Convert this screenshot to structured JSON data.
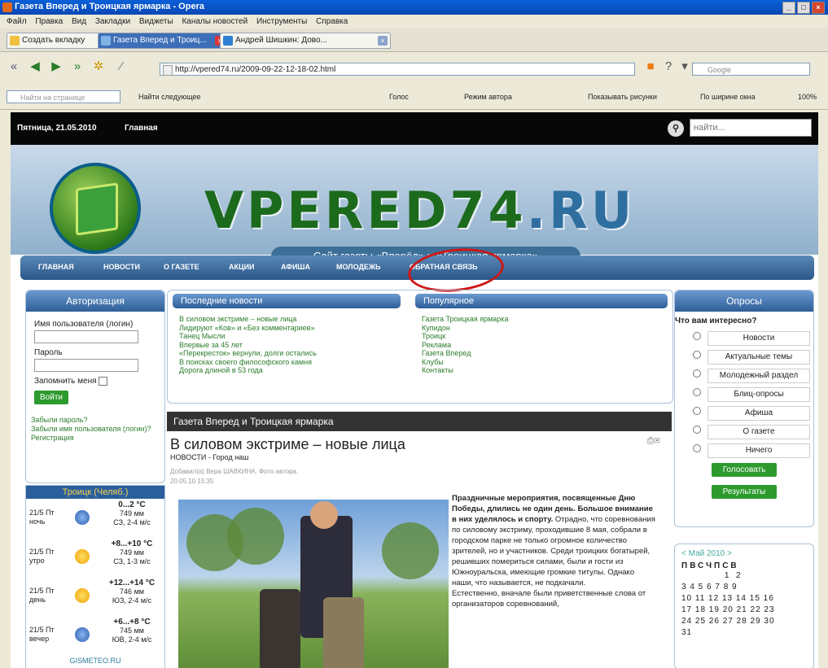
{
  "window": {
    "title": "Газета Вперед и Троицкая ярмарка - Opera"
  },
  "menu": [
    "Файл",
    "Правка",
    "Вид",
    "Закладки",
    "Виджеты",
    "Каналы новостей",
    "Инструменты",
    "Справка"
  ],
  "tabs": [
    {
      "label": "Создать вкладку"
    },
    {
      "label": "Газета Вперед и Троиц..."
    },
    {
      "label": "Андрей Шишкин: Дово..."
    }
  ],
  "address": {
    "url": "http://vpered74.ru/2009-09-22-12-18-02.html",
    "search_placeholder": "Google"
  },
  "findbar": {
    "find_placeholder": "Найти на странице",
    "find_next": "Найти следующее",
    "voice": "Голос",
    "author_mode": "Режим автора",
    "show_images": "Показывать рисунки",
    "fit_width": "По ширине окна",
    "zoom": "100%"
  },
  "page": {
    "date": "Пятница, 21.05.2010",
    "home": "Главная",
    "search_placeholder": "найти...",
    "site_title_main": "VPERED",
    "site_title_num": "74",
    "site_title_ru": ".RU",
    "subtitle": "Сайт газеты «Вперёд» и «Троицкая ярмарка»",
    "nav": [
      "ГЛАВНАЯ",
      "НОВОСТИ",
      "О ГАЗЕТЕ",
      "АКЦИИ",
      "АФИША",
      "МОЛОДЕЖЬ",
      "ОБРАТНАЯ СВЯЗЬ"
    ],
    "auth": {
      "title": "Авторизация",
      "username_label": "Имя пользователя (логин)",
      "password_label": "Пароль",
      "remember": "Запомнить меня",
      "login_btn": "Войти",
      "forgot_pass": "Забыли пароль?",
      "forgot_user": "Забыли имя пользователя (логин)?",
      "register": "Регистрация"
    },
    "weather": {
      "title": "Троицк (Челяб.)",
      "rows": [
        {
          "day": "21/5 Пт",
          "part": "ночь",
          "temp": "0...2 °C",
          "pressure": "749 мм",
          "wind": "СЗ, 2-4 м/с"
        },
        {
          "day": "21/5 Пт",
          "part": "утро",
          "temp": "+8...+10 °C",
          "pressure": "749 мм",
          "wind": "СЗ, 1-3 м/с"
        },
        {
          "day": "21/5 Пт",
          "part": "день",
          "temp": "+12...+14 °C",
          "pressure": "746 мм",
          "wind": "ЮЗ, 2-4 м/с"
        },
        {
          "day": "21/5 Пт",
          "part": "вечер",
          "temp": "+6...+8 °C",
          "pressure": "745 мм",
          "wind": "ЮВ, 2-4 м/с"
        }
      ],
      "source": "GISMETEO.RU"
    },
    "latest": {
      "title": "Последние новости",
      "items": [
        "В силовом экстриме – новые лица",
        "Лидируют «Ков» и «Без комментариев»",
        "Танец Мысли",
        "Впервые за 45 лет",
        "«Перекресток» вернули, долги остались",
        "В поисках своего философского камня",
        "Дорога длиной в 53 года"
      ]
    },
    "popular": {
      "title": "Популярное",
      "items": [
        "Газета Троицкая ярмарка",
        "Купидон",
        "Троицк",
        "Реклама",
        "Газета Вперед",
        "Клубы",
        "Контакты"
      ]
    },
    "article": {
      "section": "Газета Вперед и Троицкая ярмарка",
      "title": "В силовом экстриме – новые лица",
      "category": "НОВОСТИ - Город наш",
      "author": "Добавил(а) Вера ШАВКИНА. Фото автора.",
      "date": "20.05.10 15:35",
      "lead": "Праздничные мероприятия, посвященные Дню Победы, длились не один день. Большое внимание в них уделялось и спорту.",
      "body": "Отрадно, что соревнования по силовому экстриму, проходившие 8 мая, собрали в городском парке не только огромное количество зрителей, но и участников. Среди троицких богатырей, решивших помериться силами, были и гости из Южноуральска, имеющие громкие титулы. Однако наши, что называется, не подкачали.",
      "body2": "Естественно, вначале были приветственные слова от организаторов соревнований,"
    },
    "poll": {
      "title": "Опросы",
      "question": "Что вам интересно?",
      "options": [
        "Новости",
        "Актуальные темы",
        "Молодежный раздел",
        "Блиц-опросы",
        "Афиша",
        "О газете",
        "Ничего"
      ],
      "vote_btn": "Голосовать",
      "results_btn": "Результаты"
    },
    "calendar": {
      "month": "Май 2010",
      "weekdays": "ПВСЧПСВ",
      "rows": [
        "              1  2",
        "3  4  5  6  7  8  9",
        "10 11 12 13 14 15 16",
        "17 18 19 20 21 22 23",
        "24 25 26 27 28 29 30",
        "31"
      ]
    }
  }
}
